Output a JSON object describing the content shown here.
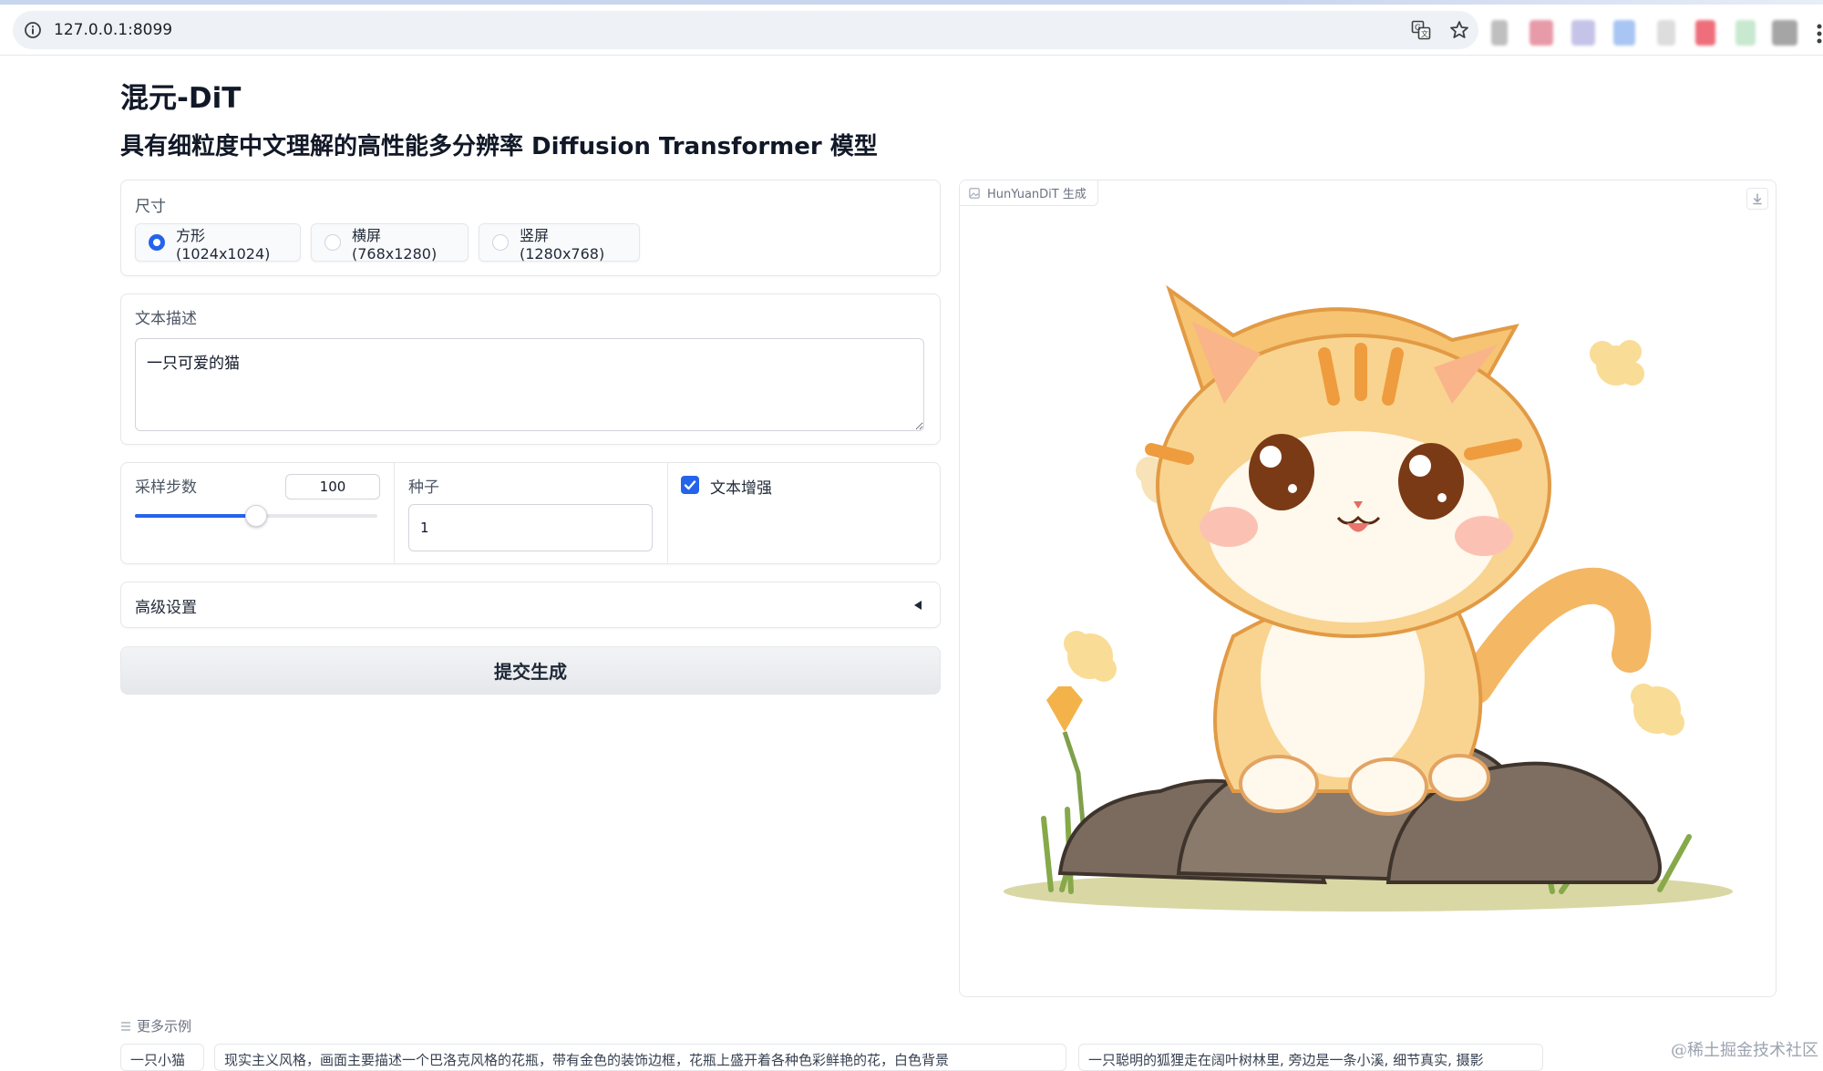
{
  "browser": {
    "url": "127.0.0.1:8099",
    "icons": [
      "info-icon",
      "translate-icon",
      "star-icon",
      "menu-icon"
    ],
    "extension_colors": [
      "#bfbfbf",
      "#e79aa8",
      "#c5c3e8",
      "#a9c5f4",
      "#dddddd",
      "#ee6f7b",
      "#c8e8cf",
      "#a5a5a5"
    ]
  },
  "header": {
    "title": "混元-DiT",
    "subtitle": "具有细粒度中文理解的高性能多分辨率 Diffusion Transformer 模型"
  },
  "size_panel": {
    "label": "尺寸",
    "options": [
      {
        "label": "方形(1024x1024)",
        "selected": true
      },
      {
        "label": "横屏(768x1280)",
        "selected": false
      },
      {
        "label": "竖屏(1280x768)",
        "selected": false
      }
    ]
  },
  "prompt_panel": {
    "label": "文本描述",
    "value": "一只可爱的猫"
  },
  "params": {
    "steps_label": "采样步数",
    "steps_value": "100",
    "steps_fraction": 0.5,
    "seed_label": "种子",
    "seed_value": "1",
    "enhance_label": "文本增强",
    "enhance_checked": true
  },
  "advanced": {
    "label": "高级设置",
    "icon": "caret-left-icon"
  },
  "submit": {
    "label": "提交生成"
  },
  "output": {
    "tag_label": "HunYuanDiT 生成",
    "icons": [
      "image-icon",
      "download-icon"
    ],
    "image_subject": "cartoon orange tabby kitten sitting on a rock"
  },
  "examples": {
    "label": "更多示例",
    "items": [
      "一只小猫",
      "现实主义风格，画面主要描述一个巴洛克风格的花瓶，带有金色的装饰边框，花瓶上盛开着各种色彩鲜艳的花，白色背景",
      "一只聪明的狐狸走在阔叶树林里, 旁边是一条小溪, 细节真实, 摄影"
    ]
  },
  "watermark": "@稀土掘金技术社区"
}
